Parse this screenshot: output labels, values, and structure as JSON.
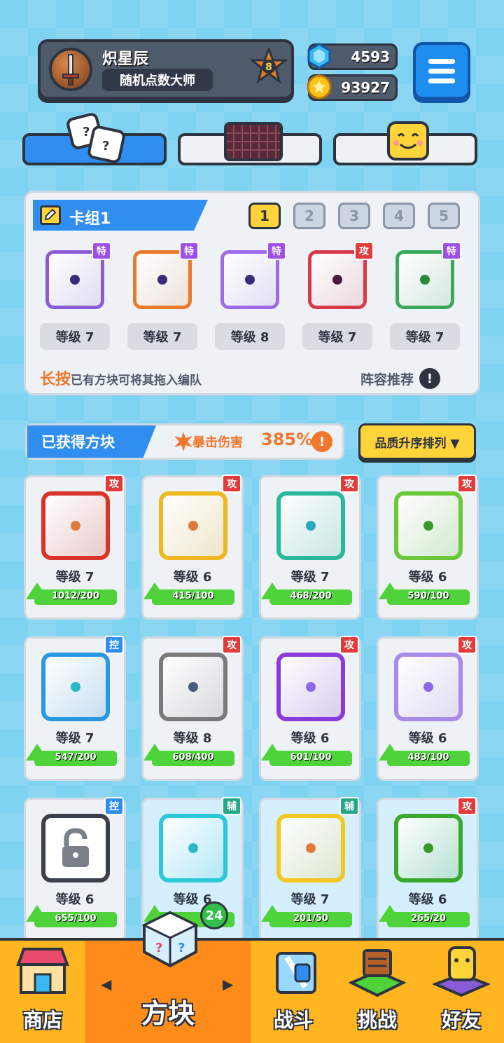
{
  "player": {
    "name": "炽星辰",
    "title": "随机点数大师",
    "rank": "8"
  },
  "currency": {
    "gems": "4593",
    "coins": "93927"
  },
  "deck": {
    "title": "卡组1",
    "numbers": [
      "1",
      "2",
      "3",
      "4",
      "5"
    ],
    "active_index": 0,
    "cards": [
      {
        "tag": "特",
        "tag_type": "spc",
        "level": "等级 7",
        "color": "#8a5ad8",
        "dot": "#3b2a7a"
      },
      {
        "tag": "特",
        "tag_type": "spc",
        "level": "等级 7",
        "color": "#e87a2a",
        "dot": "#3b2a7a"
      },
      {
        "tag": "特",
        "tag_type": "spc",
        "level": "等级 8",
        "color": "#9d6be8",
        "dot": "#3b2a7a"
      },
      {
        "tag": "攻",
        "tag_type": "atk",
        "level": "等级 7",
        "color": "#d83a4a",
        "dot": "#4a1a3a"
      },
      {
        "tag": "特",
        "tag_type": "spc",
        "level": "等级 7",
        "color": "#3aa85a",
        "dot": "#2a8a3a"
      }
    ],
    "hint_key": "长按",
    "hint_rest": "已有方块可将其拖入编队",
    "recommend": "阵容推荐"
  },
  "obtained": {
    "label": "已获得方块",
    "crit_label": "暴击伤害",
    "crit_value": "385%",
    "sort_label": "品质升序排列 ▼"
  },
  "grid": [
    {
      "tag": "攻",
      "tag_type": "atk",
      "level": "等级 7",
      "xp": "1012/200",
      "progress": 1.0,
      "color": "#d8342a",
      "dot": "#e07a3a"
    },
    {
      "tag": "攻",
      "tag_type": "atk",
      "level": "等级 6",
      "xp": "415/100",
      "progress": 1.0,
      "color": "#f0b820",
      "dot": "#e07a3a"
    },
    {
      "tag": "攻",
      "tag_type": "atk",
      "level": "等级 7",
      "xp": "468/200",
      "progress": 1.0,
      "color": "#2ab89a",
      "dot": "#2aa8b8"
    },
    {
      "tag": "攻",
      "tag_type": "atk",
      "level": "等级 6",
      "xp": "590/100",
      "progress": 1.0,
      "color": "#6ac83a",
      "dot": "#3a9a2a"
    },
    {
      "tag": "控",
      "tag_type": "ctl",
      "level": "等级 7",
      "xp": "547/200",
      "progress": 1.0,
      "color": "#2a98e0",
      "dot": "#2ab8c8"
    },
    {
      "tag": "攻",
      "tag_type": "atk",
      "level": "等级 8",
      "xp": "608/400",
      "progress": 1.0,
      "color": "#7a7a7a",
      "dot": "#4a5a7a"
    },
    {
      "tag": "攻",
      "tag_type": "atk",
      "level": "等级 6",
      "xp": "601/100",
      "progress": 1.0,
      "color": "#8a3ad8",
      "dot": "#8a6ae8"
    },
    {
      "tag": "攻",
      "tag_type": "atk",
      "level": "等级 6",
      "xp": "483/100",
      "progress": 1.0,
      "color": "#a88ae8",
      "dot": "#8a6ae8"
    },
    {
      "tag": "控",
      "tag_type": "ctl",
      "level": "等级 6",
      "xp": "655/100",
      "progress": 1.0,
      "color": "#3a3f4a",
      "dot": "#3a3f4a",
      "locked": true
    },
    {
      "tag": "辅",
      "tag_type": "sup",
      "level": "等级 6",
      "xp": "",
      "progress": 1.0,
      "color": "#2ac8d8",
      "dot": "#2ab8c8",
      "highlight": true
    },
    {
      "tag": "辅",
      "tag_type": "sup",
      "level": "等级 7",
      "xp": "201/50",
      "progress": 1.0,
      "color": "#f0c820",
      "dot": "#e07a3a",
      "highlight": true
    },
    {
      "tag": "攻",
      "tag_type": "atk",
      "level": "等级 6",
      "xp": "265/20",
      "progress": 1.0,
      "color": "#3aa82a",
      "dot": "#3a9a2a",
      "highlight": true
    }
  ],
  "nav": {
    "items": [
      "商店",
      "方块",
      "战斗",
      "挑战",
      "好友"
    ],
    "badge": "24",
    "active_index": 1
  }
}
